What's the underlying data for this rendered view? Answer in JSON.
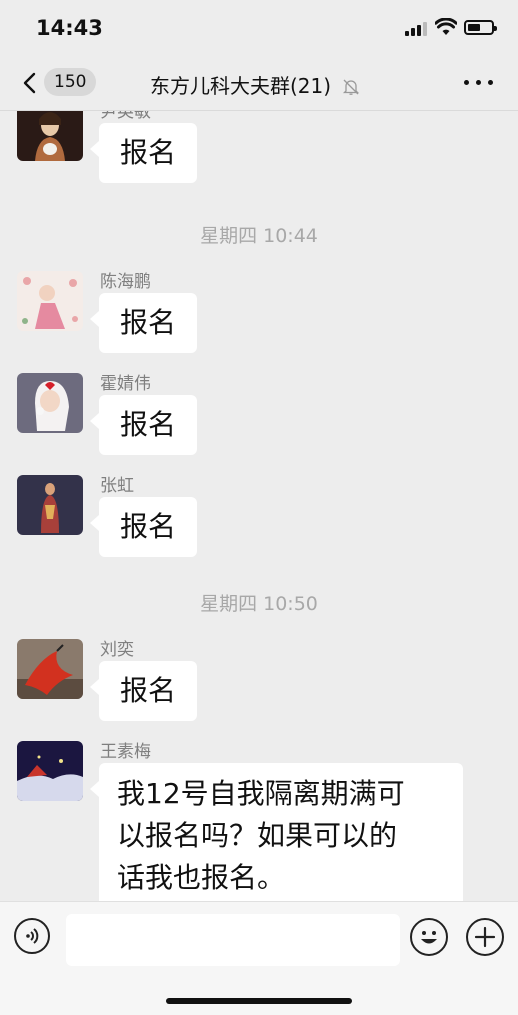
{
  "status_bar": {
    "time": "14:43"
  },
  "nav": {
    "unread_count": "150",
    "title": "东方儿科大夫群(21)"
  },
  "messages": [
    {
      "sender": "尹英敏",
      "text": "报名"
    },
    {
      "time_divider": "星期四 10:44"
    },
    {
      "sender": "陈海鹏",
      "text": "报名"
    },
    {
      "sender": "霍婧伟",
      "text": "报名"
    },
    {
      "sender": "张虹",
      "text": "报名"
    },
    {
      "time_divider": "星期四 10:50"
    },
    {
      "sender": "刘奕",
      "text": "报名"
    },
    {
      "sender": "王素梅",
      "text_lines": [
        "我12号自我隔离期满可",
        "以报名吗？如果可以的",
        "话我也报名。"
      ]
    }
  ],
  "colors": {
    "background": "#ededed",
    "bubble": "#ffffff",
    "meta_text": "#a8a8a8",
    "sender_text": "#7f7f7f"
  }
}
